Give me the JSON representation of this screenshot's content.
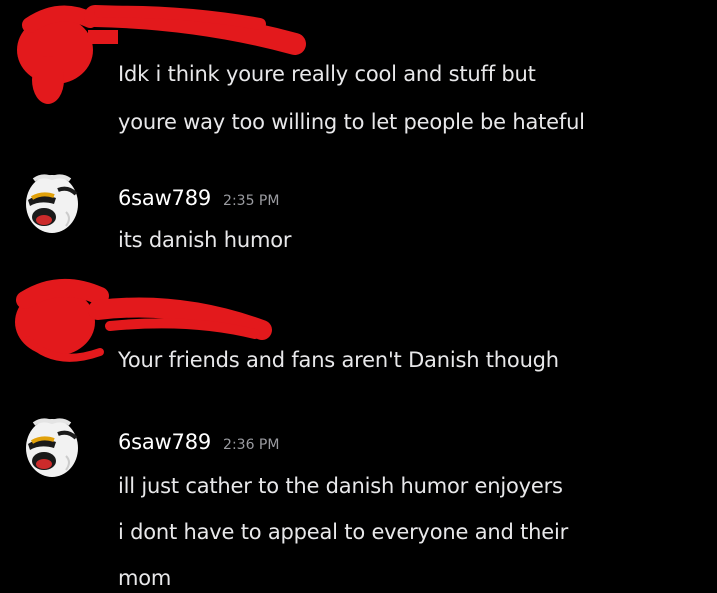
{
  "colors": {
    "background": "#000000",
    "text": "#e8e8ea",
    "username": "#ffffff",
    "timestamp": "#9a9ba0",
    "redaction": "#e3191c"
  },
  "messages": [
    {
      "author": "",
      "time": "",
      "redacted": true,
      "lines": [
        "Idk i think youre really cool and stuff but",
        "youre way too willing to let people be hateful"
      ]
    },
    {
      "author": "6saw789",
      "time": "2:35 PM",
      "avatar_icon": "screaming-face-icon",
      "lines": [
        "its danish humor"
      ]
    },
    {
      "author": "",
      "time": "",
      "redacted": true,
      "lines": [
        "Your friends and fans aren't Danish though"
      ]
    },
    {
      "author": "6saw789",
      "time": "2:36 PM",
      "avatar_icon": "screaming-face-icon",
      "lines": [
        "ill just cather to the danish humor enjoyers",
        "i dont have to appeal to everyone and their",
        "mom"
      ]
    }
  ]
}
